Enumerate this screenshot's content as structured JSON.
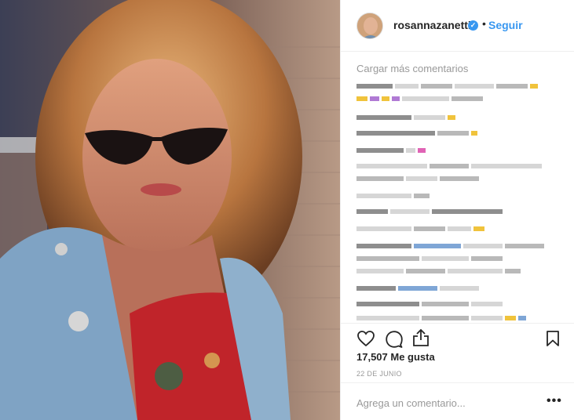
{
  "header": {
    "username": "rosannazanetti",
    "verified_mark": "✓",
    "separator": "•",
    "follow_label": "Seguir"
  },
  "comments": {
    "load_more_label": "Cargar más comentarios"
  },
  "actions": {
    "like_icon": "heart-icon",
    "comment_icon": "comment-icon",
    "share_icon": "share-icon",
    "save_icon": "bookmark-icon"
  },
  "post": {
    "likes_text": "17,507 Me gusta",
    "date_text": "22 DE JUNIO"
  },
  "add_comment": {
    "placeholder": "Agrega un comentario...",
    "more_label": "•••"
  },
  "colors": {
    "link": "#3897f0",
    "muted": "#999999",
    "text": "#262626",
    "border": "#efefef"
  }
}
